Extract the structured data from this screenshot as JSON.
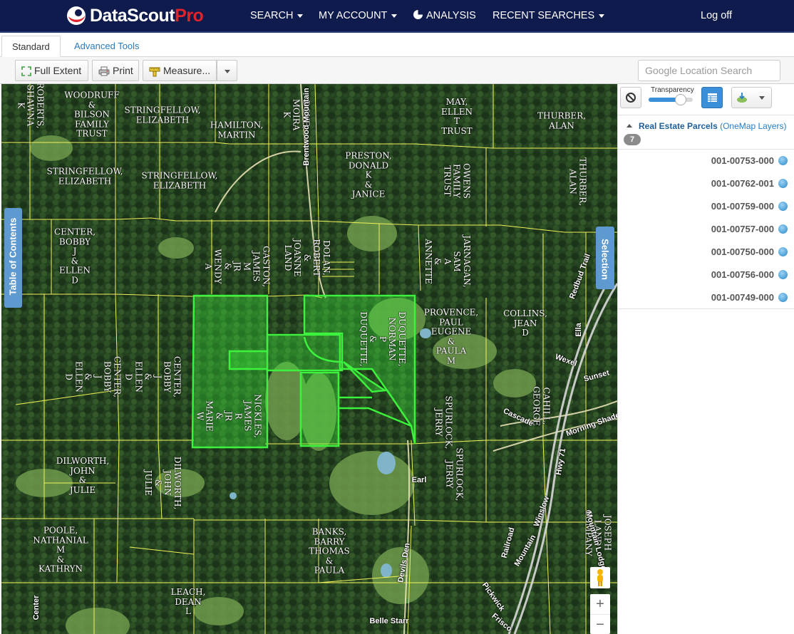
{
  "app": {
    "brand_main": "DataScout",
    "brand_suffix": "Pro",
    "brand_color": "#e2232a",
    "navbar_color": "#0f1a4d"
  },
  "nav": {
    "search": "SEARCH",
    "account": "MY ACCOUNT",
    "analysis": "ANALYSIS",
    "recent": "RECENT SEARCHES",
    "logoff": "Log off"
  },
  "tabs": [
    {
      "label": "Standard",
      "active": true
    },
    {
      "label": "Advanced Tools",
      "active": false
    }
  ],
  "toolbar": {
    "full_extent": "Full Extent",
    "print": "Print",
    "measure": "Measure...",
    "search_placeholder": "Google Location Search"
  },
  "map": {
    "side_tabs": {
      "toc": "Table of Contents",
      "selection": "Selection"
    },
    "selection_color": "#3cf23c",
    "parcel_line_color": "#f2f25a",
    "owner_labels": [
      "ROBERTS,\nSHAWNA\nK",
      "WOODRUFF\n&\nBILSON\nFAMILY\nTRUST",
      "STRINGFELLOW,\nELIZABETH",
      "HAMILTON,\nMARTIN",
      "DOVE,\nMOIRA\nK",
      "PRESTON,\nDONALD\nK\n&\nJANICE",
      "MAY,\nELLEN\nT\nTRUST",
      "THURBER,\nALAN",
      "STRINGFELLOW,\nELIZABETH",
      "STRINGFELLOW,\nELIZABETH",
      "OWENS\nFAMILY\nTRUST",
      "THURBER,\nALAN",
      "CENTER,\nBOBBY\nJ\n&\nELLEN\nD",
      "GASTON,\nJAMES\nM\nJR\n&\nWENDY\nA",
      "DOLAN,\nROBERT\n&\nJOANNE\nLAND",
      "JARNAGAN,\nSAM\nA\n&\nANNETTE",
      "DUQUETTE,\nNORMAN\nP\n&\nDUQUETTE,",
      "PROVENCE,\nPAUL\nEUGENE\n&\nPAULA\nM",
      "COLLINS,\nJEAN\nD",
      "CENTER,\nBOBBY\nJ\n&\nELLEN\nD",
      "CENTER,\nBOBBY\nJ\n&\nELLEN\nD",
      "NICKLES,\nJAMES\nR\nJR\n&\nMARIE\nW",
      "CAHILL,\nGEORGE",
      "SPURLOCK,\nJERRY",
      "DILWORTH,\nJOHN\n&\nJULIE",
      "DILWORTH,\nJOHN\n&\nJULIE",
      "SPURLOCK,\nJERRY",
      "POOLE,\nNATHANIAL\nM\n&\nKATHRYN",
      "BANKS,\nBARRY\nTHOMAS\n&\nPAULA",
      "JOSEPH\nLAND\nCOMPANY",
      "LEACH,\nDEAN\nL"
    ],
    "road_labels": [
      "Brentwood Mountain",
      "Redbud Trail",
      "Ella",
      "Wexel",
      "Sunset",
      "Cascade",
      "Morning Shade",
      "Winslow",
      "Hwy 71",
      "Earl",
      "Devils Den",
      "Railroad",
      "Mountain",
      "Mountain Lodge",
      "Frisco",
      "Pickwick",
      "Belle Starr",
      "Center"
    ],
    "zoom_in": "+",
    "zoom_out": "−"
  },
  "panel": {
    "transparency_label": "Transparency",
    "transparency_value": 0.72,
    "layer_name": "Real Estate Parcels",
    "layer_source": "(OneMap Layers)",
    "count": "7",
    "parcels": [
      "001-00753-000",
      "001-00762-001",
      "001-00759-000",
      "001-00757-000",
      "001-00750-000",
      "001-00756-000",
      "001-00749-000"
    ]
  }
}
